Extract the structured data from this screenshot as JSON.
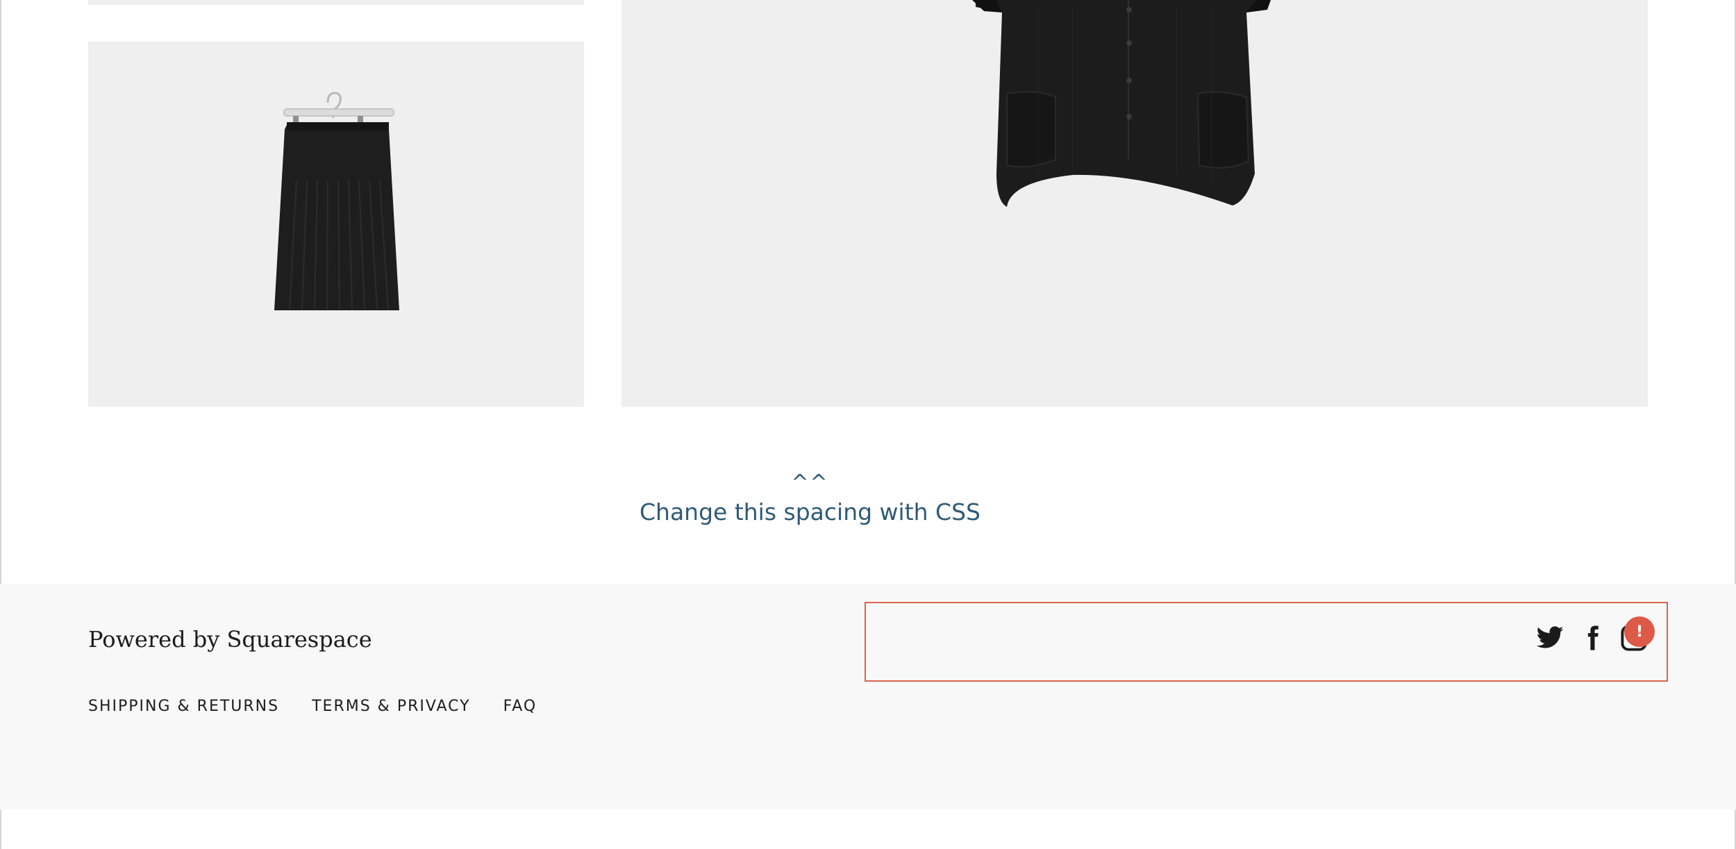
{
  "annotation": {
    "caret": "^^",
    "text": "Change this spacing with CSS"
  },
  "footer": {
    "brand": "Powered by Squarespace",
    "nav": [
      {
        "label": "SHIPPING & RETURNS"
      },
      {
        "label": "TERMS & PRIVACY"
      },
      {
        "label": "FAQ"
      }
    ],
    "social_icons": [
      "twitter-icon",
      "facebook-icon",
      "instagram-icon"
    ],
    "alert_badge": "!"
  },
  "colors": {
    "annotation_text": "#2e5a77",
    "highlight_border": "#d9644e",
    "alert_badge": "#de5a46",
    "footer_bg": "#f8f8f8",
    "image_bg": "#efefef"
  }
}
